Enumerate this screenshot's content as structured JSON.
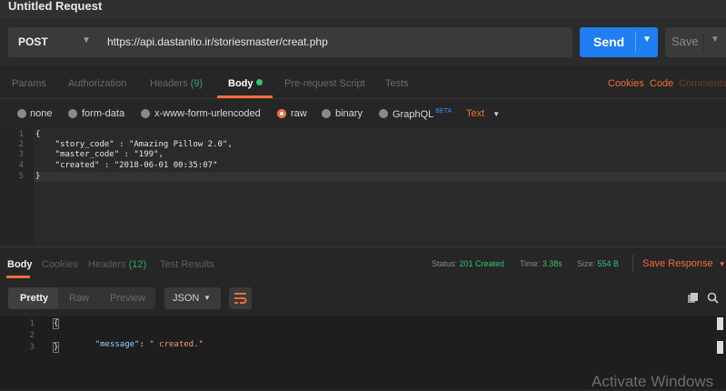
{
  "window": {
    "title": "Untitled Request"
  },
  "request": {
    "method": "POST",
    "url": "https://api.dastanito.ir/storiesmaster/creat.php",
    "send_label": "Send",
    "save_label": "Save"
  },
  "request_tabs": {
    "params": "Params",
    "authorization": "Authorization",
    "headers": "Headers",
    "headers_count": "(9)",
    "body": "Body",
    "pre_request": "Pre-request Script",
    "tests": "Tests",
    "cookies": "Cookies",
    "code": "Code",
    "comments": "Comments"
  },
  "body_types": {
    "none": "none",
    "form_data": "form-data",
    "urlencoded": "x-www-form-urlencoded",
    "raw": "raw",
    "binary": "binary",
    "graphql": "GraphQL",
    "beta": "BETA",
    "text_mode": "Text"
  },
  "request_body": {
    "line_numbers": [
      "1",
      "2",
      "3",
      "4",
      "5"
    ],
    "lines": [
      "{",
      "    \"story_code\" : \"Amazing Pillow 2.0\",",
      "    \"master_code\" : \"199\",",
      "    \"created\" : \"2018-06-01 00:35:07\"",
      "}"
    ]
  },
  "response_tabs": {
    "body": "Body",
    "cookies": "Cookies",
    "headers": "Headers",
    "headers_count": "(12)",
    "test_results": "Test Results"
  },
  "response_status": {
    "status_label": "Status:",
    "status_value": "201 Created",
    "time_label": "Time:",
    "time_value": "3.38s",
    "size_label": "Size:",
    "size_value": "554 B",
    "save_response": "Save Response"
  },
  "response_toolbar": {
    "pretty": "Pretty",
    "raw": "Raw",
    "preview": "Preview",
    "format": "JSON"
  },
  "response_body": {
    "line_numbers": [
      "1",
      "2",
      "3"
    ],
    "brace_open": "{",
    "key": "\"message\"",
    "colon": ": ",
    "value": "\" created.\"",
    "brace_close": "}"
  },
  "os_watermark": "Activate Windows",
  "colors": {
    "accent": "#f26b3a",
    "primary": "#1f7ef0",
    "success": "#30c474"
  }
}
